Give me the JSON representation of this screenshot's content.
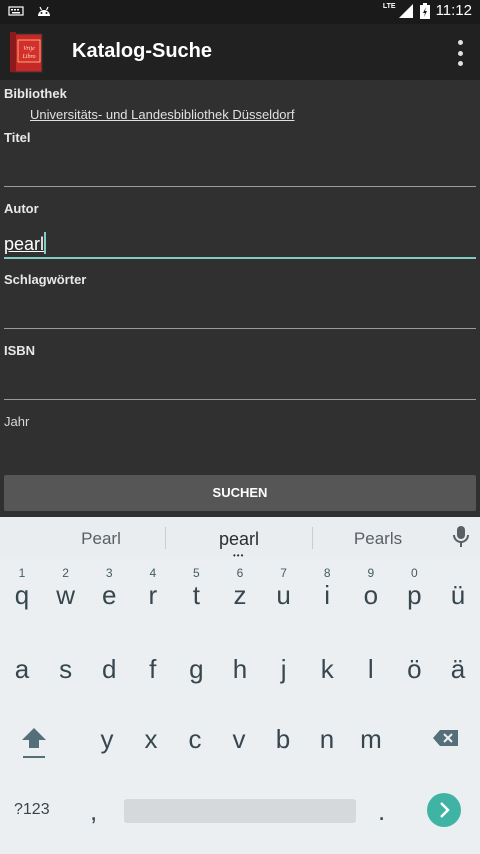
{
  "status_bar": {
    "time": "11:12",
    "network": "LTE"
  },
  "app_bar": {
    "title": "Katalog-Suche",
    "logo_text": "Vrije Libro"
  },
  "form": {
    "library_label": "Bibliothek",
    "library_value": "Universitäts- und Landesbibliothek Düsseldorf",
    "title_label": "Titel",
    "title_value": "",
    "author_label": "Autor",
    "author_value": "pearl",
    "keywords_label": "Schlagwörter",
    "keywords_value": "",
    "isbn_label": "ISBN",
    "isbn_value": "",
    "year_label": "Jahr",
    "year_value": "",
    "search_button": "SUCHEN"
  },
  "keyboard": {
    "suggestions": [
      "Pearl",
      "pearl",
      "Pearls"
    ],
    "row1": [
      {
        "ch": "q",
        "hint": "1"
      },
      {
        "ch": "w",
        "hint": "2"
      },
      {
        "ch": "e",
        "hint": "3"
      },
      {
        "ch": "r",
        "hint": "4"
      },
      {
        "ch": "t",
        "hint": "5"
      },
      {
        "ch": "z",
        "hint": "6"
      },
      {
        "ch": "u",
        "hint": "7"
      },
      {
        "ch": "i",
        "hint": "8"
      },
      {
        "ch": "o",
        "hint": "9"
      },
      {
        "ch": "p",
        "hint": "0"
      },
      {
        "ch": "ü",
        "hint": ""
      }
    ],
    "row2": [
      "a",
      "s",
      "d",
      "f",
      "g",
      "h",
      "j",
      "k",
      "l",
      "ö",
      "ä"
    ],
    "row3": [
      "y",
      "x",
      "c",
      "v",
      "b",
      "n",
      "m"
    ],
    "symbols_label": "?123",
    "comma": ",",
    "period": "."
  },
  "colors": {
    "accent": "#80cbc4",
    "enter": "#3fb3a4",
    "app_bar": "#212121",
    "background": "#303030"
  }
}
